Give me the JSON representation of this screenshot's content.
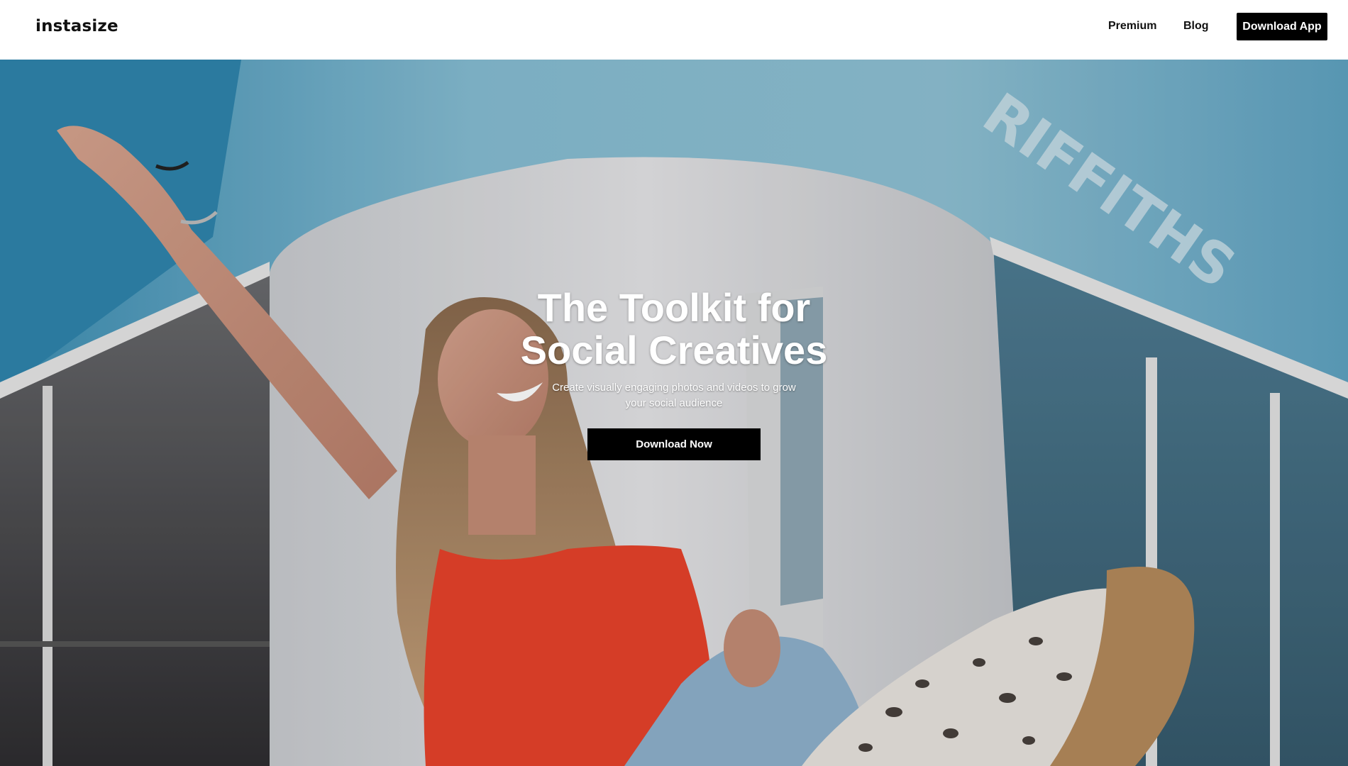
{
  "header": {
    "logo_text": "instasize",
    "nav": {
      "premium_label": "Premium",
      "blog_label": "Blog",
      "download_app_label": "Download App"
    }
  },
  "hero": {
    "title_line1": "The Toolkit for",
    "title_line2": "Social Creatives",
    "subtitle_line1": "Create visually engaging photos and videos to grow",
    "subtitle_line2": "your social audience",
    "cta_label": "Download Now"
  },
  "colors": {
    "header_background": "#ffffff",
    "button_background": "#000000",
    "button_text": "#ffffff",
    "wall_blue": "#6fb3cf",
    "top_red": "#e8432b"
  }
}
